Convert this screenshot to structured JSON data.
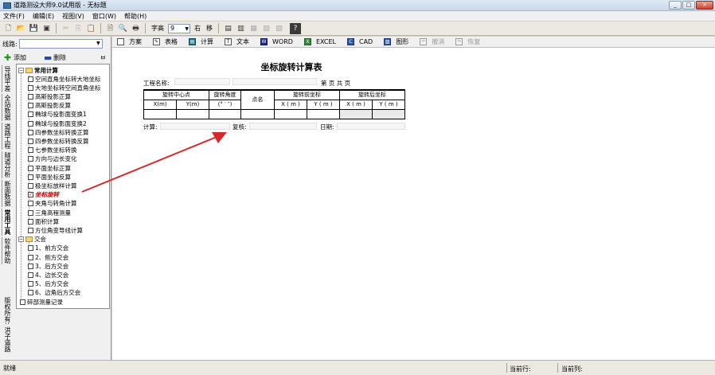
{
  "window": {
    "title": "道路测设大师9.0试用版 - 无标题",
    "controls": [
      "_",
      "□",
      "×"
    ]
  },
  "menu": [
    "文件(F)",
    "编辑(E)",
    "视图(V)",
    "窗口(W)",
    "帮助(H)"
  ],
  "toolbar": {
    "font_label": "字高",
    "font_size": "9",
    "align_right": "右",
    "align_move": "移",
    "help": "?"
  },
  "left_panel": {
    "route_label": "线路:",
    "route_value": "",
    "add_label": "添加",
    "delete_label": "删除",
    "pin": "ㅂ",
    "vertical_tabs": [
      "导线平差",
      "全站数据",
      "道路工程",
      "隧道分析",
      "断面数据",
      "常用工具",
      "软件帮助",
      "版权所有: 洪子道路"
    ],
    "active_tab": "常用工具",
    "tree": {
      "group1": "常用计算",
      "group1_items": [
        "空间直角坐标转大地坐标",
        "大地坐标转空间直角坐标",
        "高斯投影正算",
        "高斯投影反算",
        "椭球与投影面变换1",
        "椭球与投影面变换2",
        "四参数坐标转换正算",
        "四参数坐标转换反算",
        "七参数坐标转换",
        "方向与边长变化",
        "平面坐标正算",
        "平面坐标反算",
        "极坐标放样计算",
        "坐标旋转",
        "夹角与转角计算",
        "三角高程测量",
        "面积计算",
        "方位角变导线计算"
      ],
      "selected": "坐标旋转",
      "group2": "交会",
      "group2_items": [
        "1、前方交会",
        "2、侧方交会",
        "3、后方交会",
        "4、边长交会",
        "5、后方交会",
        "6、边角后方交会"
      ],
      "bottom_item": "碎部测量记录"
    }
  },
  "doc_toolbar": {
    "items": [
      {
        "label": "方案",
        "icon": "new-doc-icon",
        "enabled": true
      },
      {
        "label": "表格",
        "icon": "table-icon",
        "enabled": true
      },
      {
        "label": "计算",
        "icon": "calculate-icon",
        "enabled": true
      },
      {
        "label": "文本",
        "icon": "text-icon",
        "enabled": true
      },
      {
        "label": "WORD",
        "icon": "word-icon",
        "enabled": true
      },
      {
        "label": "EXCEL",
        "icon": "excel-icon",
        "enabled": true
      },
      {
        "label": "CAD",
        "icon": "cad-icon",
        "enabled": true
      },
      {
        "label": "图形",
        "icon": "graph-icon",
        "enabled": true
      },
      {
        "label": "撤消",
        "icon": "undo-icon",
        "enabled": false
      },
      {
        "label": "恢复",
        "icon": "redo-icon",
        "enabled": false
      }
    ]
  },
  "form": {
    "title": "坐标旋转计算表",
    "project_label": "工程名称:",
    "page_label": "第    页   共    页",
    "headers": {
      "rotation_center": "旋转中心点",
      "rotation_angle": "旋转角度",
      "point_name": "点名",
      "before": "旋转前坐标",
      "after": "旋转后坐标",
      "xm": "X(m)",
      "ym": "Y(m)",
      "xm2": "X ( m )",
      "ym2": "Y ( m )",
      "angle_unit": "(° ′ ″)"
    },
    "calc_label": "计算:",
    "review_label": "复核:",
    "date_label": "日期:"
  },
  "status": {
    "left": "就绪",
    "current_row_label": "当前行:",
    "current_col_label": "当前列:"
  },
  "colors": {
    "selected_item": "#cc0000",
    "arrow": "#d42a2a",
    "window_bg": "#d4d0c8"
  }
}
